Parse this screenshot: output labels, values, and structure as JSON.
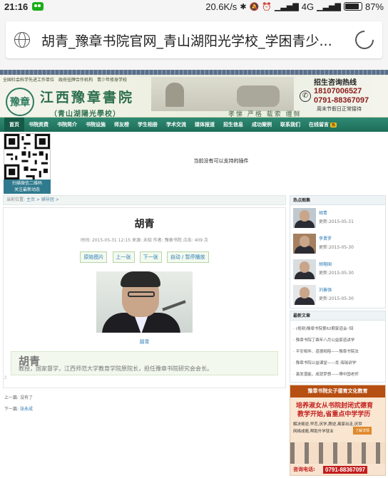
{
  "status": {
    "time": "21:16",
    "network_speed": "20.6K/s",
    "signal": "4G",
    "battery": "87%"
  },
  "url_bar": {
    "title": "胡青_豫章书院官网_青山湖阳光学校_学困青少..."
  },
  "banner": {
    "topline": "全国社会科学先进工作单位　政府挂牌合作机构　青少年修身学校",
    "logo_text": "豫章",
    "brand_name": "江西豫章書院",
    "brand_sub": "（青山湖陽光學校）",
    "motto": "孝悌 严格 载索 缠鲜",
    "hotline_title": "招生咨询热线",
    "phone1": "18107006527",
    "phone2": "0791-88367097",
    "hours": "周末节假日正常接待"
  },
  "nav": {
    "items": [
      "首页",
      "书院资费",
      "书院简介",
      "书院设施",
      "师友榜",
      "学生相册",
      "学术交流",
      "媒体报道",
      "招生信息",
      "成功案例",
      "联系我们",
      "在线留言"
    ],
    "hot_badge": "热"
  },
  "qr": {
    "caption1": "扫描微信二维码",
    "caption2": "关注最新动态",
    "plugin_msg": "当前没有可以支持的插件"
  },
  "breadcrumb": {
    "label": "当前位置:",
    "path": "主页 > 辅导团 >"
  },
  "article": {
    "title": "胡青",
    "meta": "时间: 2015-05-31 12:15  来源: 未知  作者: 豫章书院  点击: 409 次",
    "buttons": [
      "原始图片",
      "上一张",
      "下一张",
      "自动 / 暂停播放"
    ],
    "caption": "胡青",
    "bio_name": "胡青",
    "bio_text": "教授，国家督学，江西师范大学教育学院原院长，担任豫章书院研究会会长。",
    "side_mark": "上",
    "prev_label": "上一篇:",
    "prev_value": "没有了",
    "next_label": "下一篇:",
    "next_value": "张永成"
  },
  "sidebar": {
    "hot_title": "热点图集",
    "hot_items": [
      {
        "name": "胡青",
        "updated": "更新:2015-05-31"
      },
      {
        "name": "李晋罗",
        "updated": "更新:2015-05-30"
      },
      {
        "name": "胡榕国",
        "updated": "更新:2015-05-30"
      },
      {
        "name": "刘善强",
        "updated": "更新:2015-05-30"
      }
    ],
    "news_title": "最新文章",
    "news_items": [
      "(视频)豫章书院第62期家道会-'回",
      "豫章书院丁酉年八月公益家道讲学",
      "平安相伴、道德相陪——豫章书院法",
      "豫章书院公益课堂——肯·海瑞讲学'",
      "激发潜能，成就梦想——傅中国老师"
    ],
    "ad": {
      "header": "豫章书院女子德育文化教育",
      "line1": "培养淑女从书院封闭式德育",
      "line2": "教学开始,省重点中学学历",
      "line3": "解决叛逆,早恋,厌学,脾逆,离家出走,厌世",
      "line4": "网络成瘾,帮助升学就业",
      "tag": "了解详情",
      "tel_label": "咨询电话:",
      "tel_number": "0791-88367097"
    }
  }
}
